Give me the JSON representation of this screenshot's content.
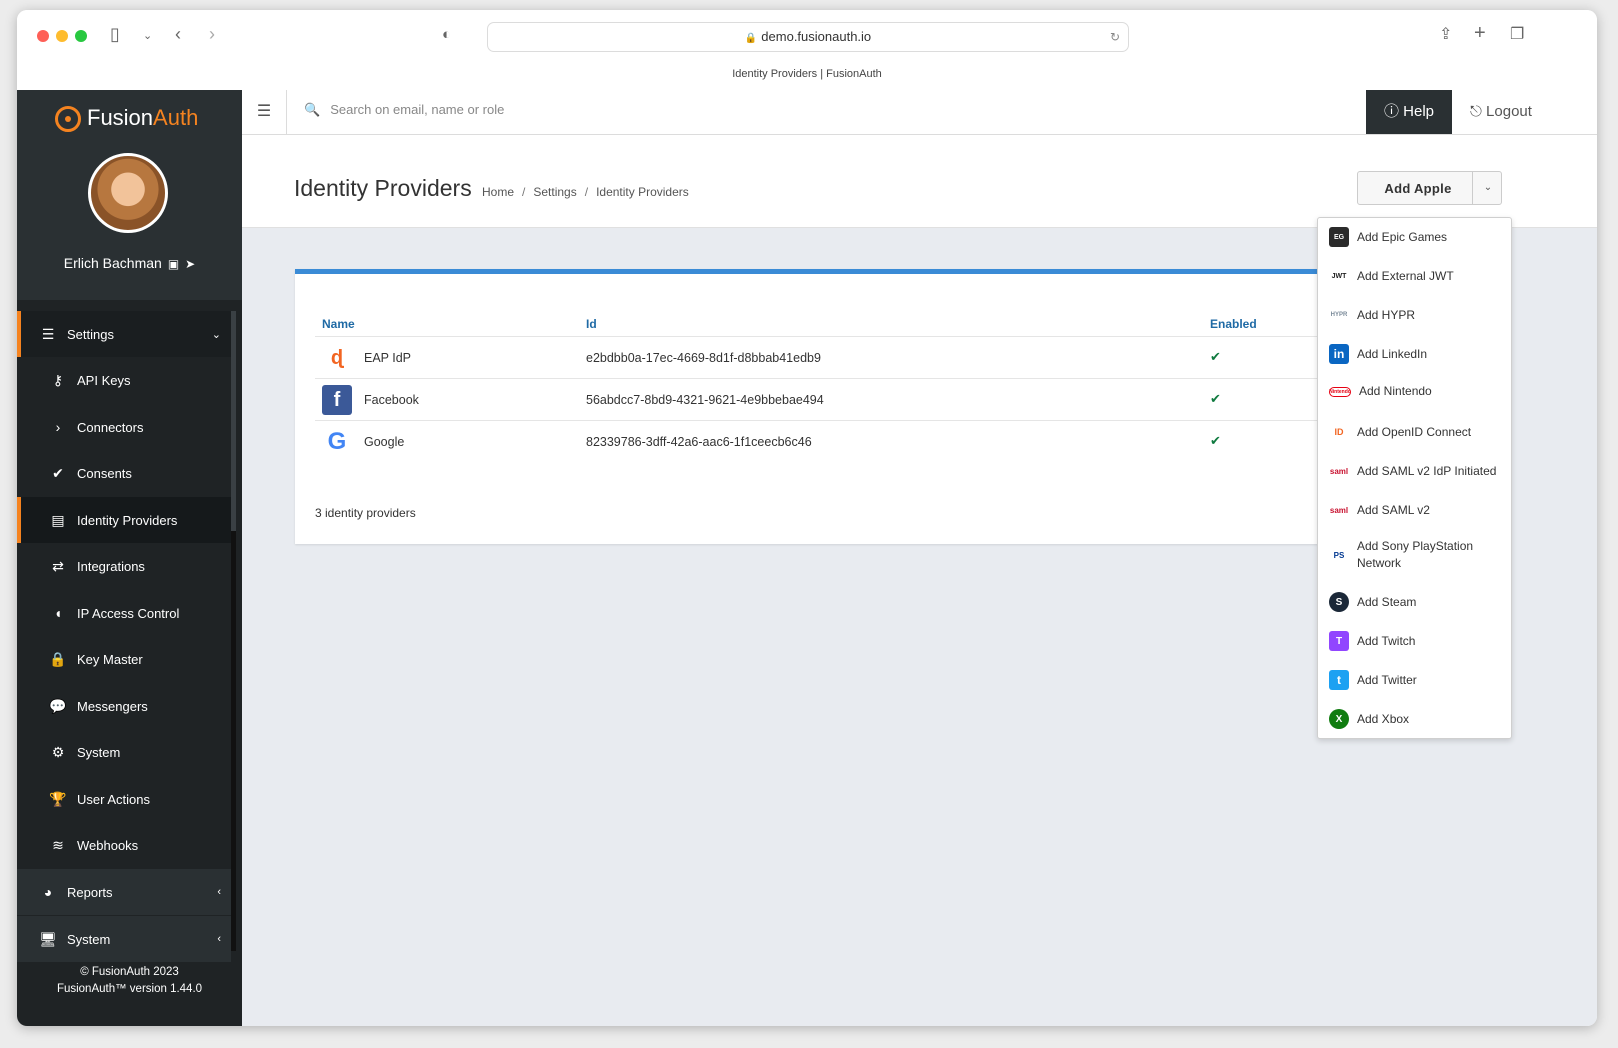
{
  "browser": {
    "url": "demo.fusionauth.io",
    "tab_title": "Identity Providers | FusionAuth"
  },
  "sidebar": {
    "logo_text": "Fusion",
    "logo_accent": "Auth",
    "user_name": "Erlich Bachman",
    "settings_label": "Settings",
    "items": [
      {
        "label": "API Keys",
        "icon": "key-icon"
      },
      {
        "label": "Connectors",
        "icon": "chevron-right-icon"
      },
      {
        "label": "Consents",
        "icon": "check-icon"
      },
      {
        "label": "Identity Providers",
        "icon": "id-badge-icon"
      },
      {
        "label": "Integrations",
        "icon": "exchange-icon"
      },
      {
        "label": "IP Access Control",
        "icon": "shield-icon"
      },
      {
        "label": "Key Master",
        "icon": "lock-icon"
      },
      {
        "label": "Messengers",
        "icon": "comments-icon"
      },
      {
        "label": "System",
        "icon": "gear-icon"
      },
      {
        "label": "User Actions",
        "icon": "trophy-icon"
      },
      {
        "label": "Webhooks",
        "icon": "rss-icon"
      }
    ],
    "reports_label": "Reports",
    "system_label": "System",
    "footer_copyright": "© FusionAuth 2023",
    "footer_version": "FusionAuth™ version 1.44.0"
  },
  "topbar": {
    "search_placeholder": "Search on email, name or role",
    "help_label": "Help",
    "logout_label": "Logout"
  },
  "page": {
    "title": "Identity Providers",
    "breadcrumb": [
      "Home",
      "Settings",
      "Identity Providers"
    ],
    "add_button_label": "Add Apple"
  },
  "table": {
    "headers": {
      "name": "Name",
      "id": "Id",
      "enabled": "Enabled"
    },
    "rows": [
      {
        "name": "EAP IdP",
        "id": "e2bdbb0a-17ec-4669-8d1f-d8bbab41edb9",
        "enabled": "✔"
      },
      {
        "name": "Facebook",
        "id": "56abdcc7-8bd9-4321-9621-4e9bbebae494",
        "enabled": "✔"
      },
      {
        "name": "Google",
        "id": "82339786-3dff-42a6-aac6-1f1ceecb6c46",
        "enabled": "✔"
      }
    ],
    "count_text": "3 identity providers"
  },
  "dropdown": {
    "items": [
      {
        "label": "Add Epic Games",
        "icon_text": "EG"
      },
      {
        "label": "Add External JWT",
        "icon_text": "JWT"
      },
      {
        "label": "Add HYPR",
        "icon_text": "HYPR"
      },
      {
        "label": "Add LinkedIn",
        "icon_text": "in"
      },
      {
        "label": "Add Nintendo",
        "icon_text": "Nintendo"
      },
      {
        "label": "Add OpenID Connect",
        "icon_text": "ID"
      },
      {
        "label": "Add SAML v2 IdP Initiated",
        "icon_text": "saml"
      },
      {
        "label": "Add SAML v2",
        "icon_text": "saml"
      },
      {
        "label": "Add Sony PlayStation Network",
        "icon_text": "PS"
      },
      {
        "label": "Add Steam",
        "icon_text": "S"
      },
      {
        "label": "Add Twitch",
        "icon_text": "T"
      },
      {
        "label": "Add Twitter",
        "icon_text": "t"
      },
      {
        "label": "Add Xbox",
        "icon_text": "X"
      }
    ]
  },
  "colors": {
    "accent": "#f58320",
    "sidebar_bg": "#1f2325",
    "header_link": "#1f6aa5",
    "panel_border": "#3a8bd6",
    "enabled_check": "#0f7a3f"
  }
}
